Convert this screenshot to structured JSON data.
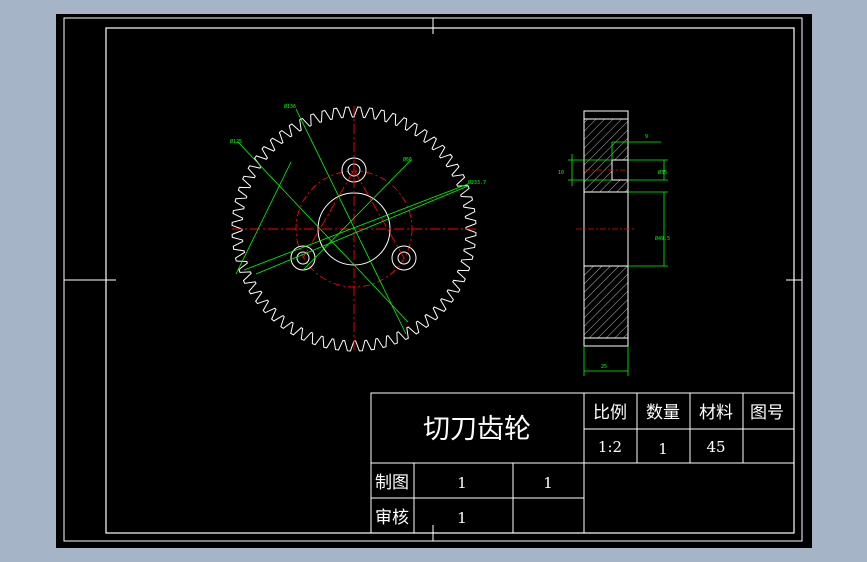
{
  "title_block": {
    "part_name": "切刀齿轮",
    "headers": {
      "scale": "比例",
      "quantity": "数量",
      "material": "材料",
      "drawing_no": "图号"
    },
    "values": {
      "scale": "1:2",
      "quantity": "1",
      "material": "45",
      "drawing_no": ""
    },
    "drawn_by_label": "制图",
    "drawn_by_value": "1",
    "drawn_extra": "1",
    "checked_by_label": "审核",
    "checked_by_value": "1"
  },
  "dimensions": {
    "gear_label_1": "Ø125",
    "gear_label_2": "Ø136",
    "gear_label_3": "Ø66",
    "gear_label_4": "Ø233.7",
    "side_top": "9",
    "side_left": "10",
    "side_right_1": "Ø35",
    "side_right_2": "Ø49.5",
    "side_width": "25"
  },
  "gear": {
    "teeth": 64
  },
  "colors": {
    "background": "#a6b4c8",
    "sheet": "#000000",
    "line": "#ffffff",
    "dimension": "#00ff00",
    "center_line": "#ff0000"
  }
}
